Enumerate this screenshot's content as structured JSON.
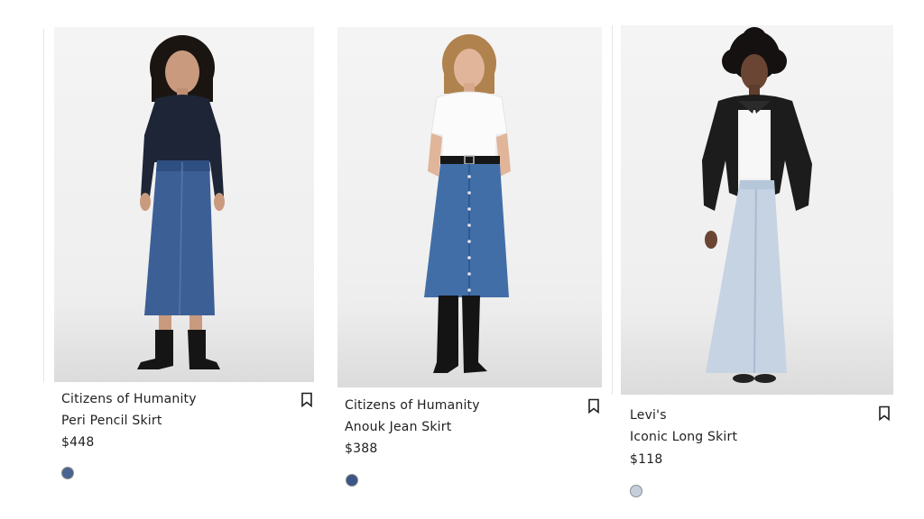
{
  "products": [
    {
      "brand": "Citizens of Humanity",
      "name": "Peri Pencil Skirt",
      "price": "$448",
      "swatch_color": "#4a6491",
      "icon": "bookmark-icon"
    },
    {
      "brand": "Citizens of Humanity",
      "name": "Anouk Jean Skirt",
      "price": "$388",
      "swatch_color": "#3c5587",
      "icon": "bookmark-icon"
    },
    {
      "brand": "Levi's",
      "name": "Iconic Long Skirt",
      "price": "$118",
      "swatch_color": "#c5cfdc",
      "icon": "bookmark-icon"
    }
  ],
  "colors": {
    "text": "#1f1f1f",
    "background": "#ffffff",
    "photo_background": "#f2f2f2"
  }
}
